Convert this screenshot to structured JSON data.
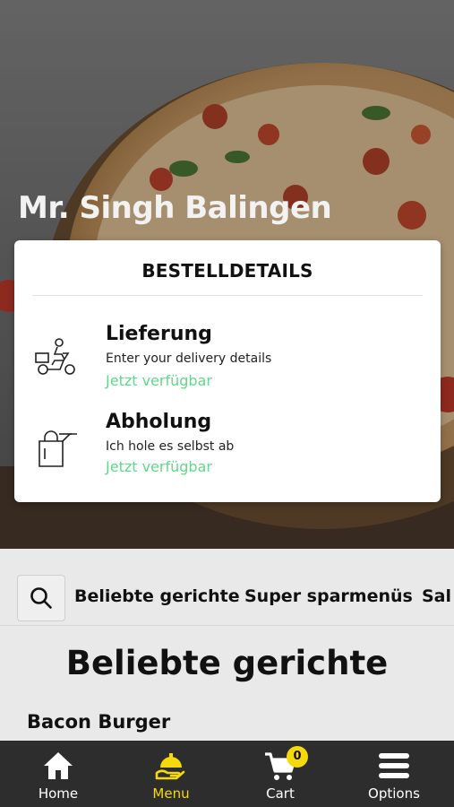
{
  "restaurant": {
    "name": "Mr. Singh Balingen"
  },
  "order_details": {
    "title": "BESTELLDETAILS",
    "options": [
      {
        "title": "Lieferung",
        "subtitle": "Enter your delivery details",
        "availability": "Jetzt verfügbar",
        "icon": "delivery-scooter-icon"
      },
      {
        "title": "Abholung",
        "subtitle": "Ich hole es selbst ab",
        "availability": "Jetzt verfügbar",
        "icon": "pickup-bag-icon"
      }
    ]
  },
  "categories": [
    "Beliebte gerichte",
    "Super sparmenüs",
    "Sal"
  ],
  "section": {
    "title": "Beliebte gerichte",
    "first_item": "Bacon Burger"
  },
  "bottom_nav": {
    "items": [
      {
        "label": "Home",
        "icon": "home-icon"
      },
      {
        "label": "Menu",
        "icon": "menu-cloche-icon",
        "active": true
      },
      {
        "label": "Cart",
        "icon": "cart-icon"
      },
      {
        "label": "Options",
        "icon": "hamburger-icon"
      }
    ],
    "cart_count": "0"
  },
  "colors": {
    "accent": "#f5d90a",
    "available": "#5fd98a",
    "nav_bg": "#2d2d2d"
  }
}
